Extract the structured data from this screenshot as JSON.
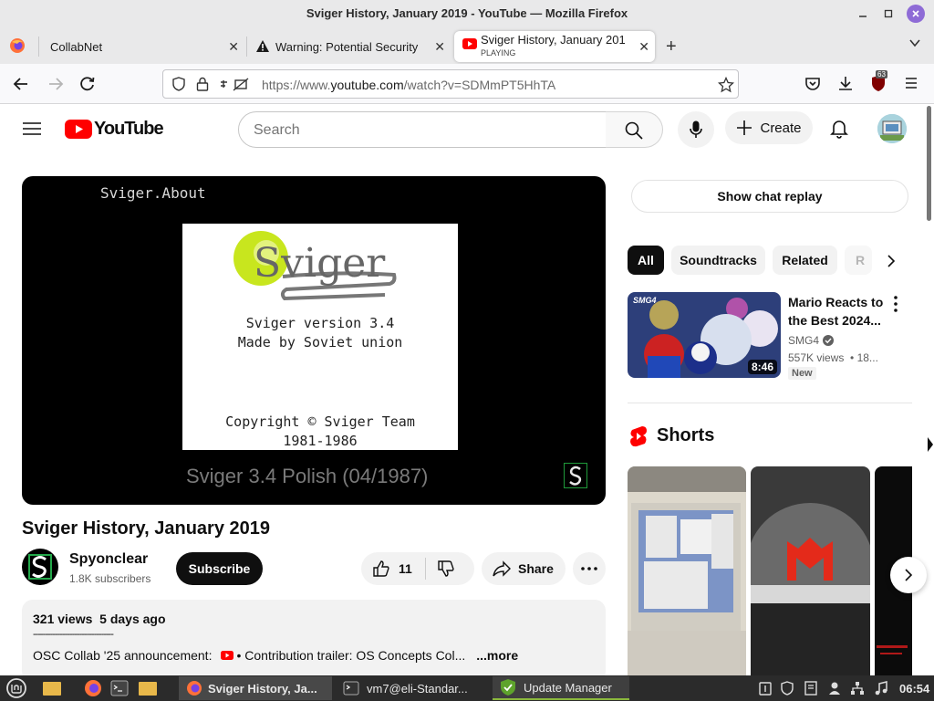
{
  "window": {
    "title": "Sviger History, January 2019 - YouTube — Mozilla Firefox"
  },
  "tabs": [
    {
      "label": "CollabNet"
    },
    {
      "label": "Warning: Potential Security"
    },
    {
      "label": "Sviger History, January 201",
      "status": "PLAYING"
    }
  ],
  "address": {
    "prefix": "https://www.",
    "domain": "youtube.com",
    "path": "/watch?v=SDMmPT5HhTA"
  },
  "extensions": {
    "ublock_count": "63"
  },
  "youtube": {
    "logo": "YouTube",
    "search_placeholder": "Search",
    "create_label": "Create"
  },
  "video": {
    "caption_top": "Sviger.About",
    "logo_word": "Sviger",
    "version_line1": "Sviger version 3.4",
    "version_line2": "Made by Soviet union",
    "copyright_line1": "Copyright © Sviger Team",
    "copyright_line2": "1981-1986",
    "caption_bottom": "Sviger 3.4 Polish (04/1987)",
    "title": "Sviger History, January 2019"
  },
  "channel": {
    "name": "Spyonclear",
    "subscribers": "1.8K subscribers",
    "subscribe_label": "Subscribe"
  },
  "actions": {
    "likes": "11",
    "share_label": "Share"
  },
  "description": {
    "stats": "321 views  5 days ago",
    "divider": "---------------------------------",
    "line_prefix": "OSC Collab '25 announcement:",
    "line_link": "• Contribution trailer: OS Concepts Col...",
    "more_label": "...more"
  },
  "sidebar": {
    "chat_replay": "Show chat replay",
    "chips": [
      "All",
      "Soundtracks",
      "Related",
      "R"
    ],
    "recommended": {
      "title": "Mario Reacts to the Best 2024...",
      "channel": "SMG4",
      "meta": "557K views  • 18...",
      "badge": "New",
      "duration": "8:46",
      "thumb_label": "SMG4"
    },
    "shorts_heading": "Shorts"
  },
  "taskbar": {
    "items": [
      "Sviger History, Ja...",
      "vm7@eli-Standar...",
      "Update Manager"
    ],
    "clock": "06:54"
  },
  "colors": {
    "yt_red": "#ff0000",
    "accent_purple": "#8e6bd6",
    "taskbar_bg": "#2b2b2b"
  }
}
